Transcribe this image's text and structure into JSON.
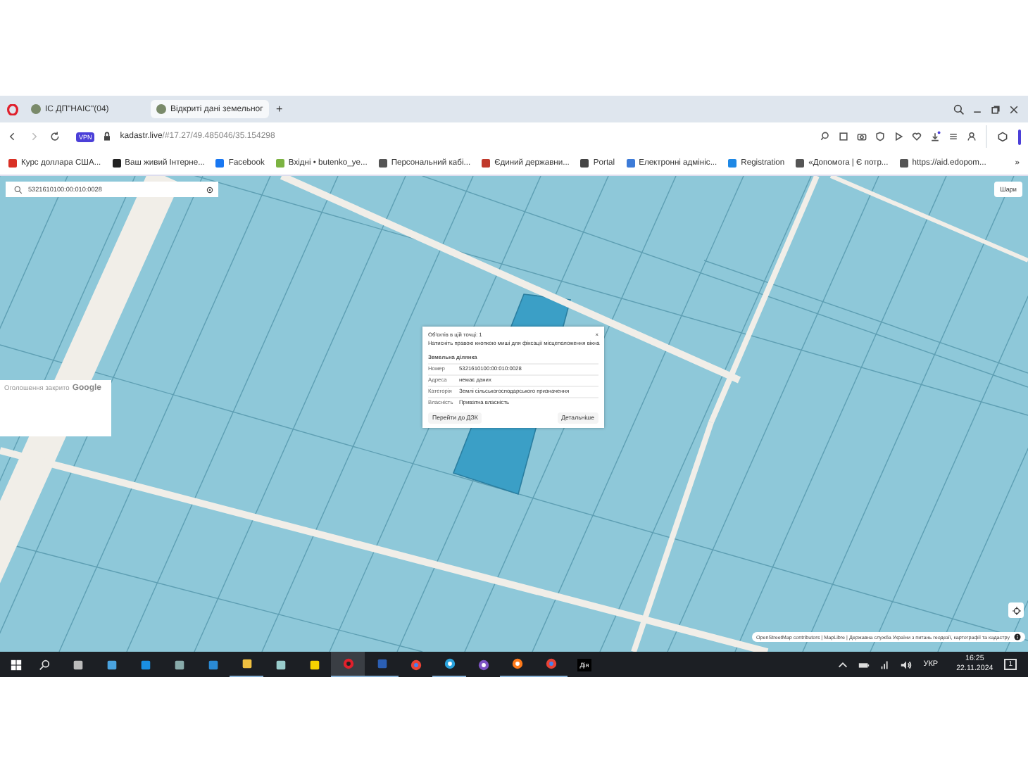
{
  "browser": {
    "tabs": [
      {
        "title": "ІС ДП\"НАІС\"(04)",
        "selected": false
      },
      {
        "title": "Відкриті дані земельног",
        "selected": true
      }
    ],
    "new_tab": "+",
    "address": {
      "host": "kadastr.live",
      "path": "/#17.27/49.485046/35.154298",
      "vpn": "VPN"
    },
    "bookmarks": [
      {
        "kind": "letter-m",
        "title": "Курс доллара США..."
      },
      {
        "kind": "dark-circle",
        "title": "Ваш живий Інтерне..."
      },
      {
        "kind": "facebook",
        "title": "Facebook"
      },
      {
        "kind": "mailbox",
        "title": "Вхідні • butenko_ye..."
      },
      {
        "kind": "seal",
        "title": "Персональний кабі..."
      },
      {
        "kind": "person",
        "title": "Єдиний державни..."
      },
      {
        "kind": "document",
        "title": "Portal"
      },
      {
        "kind": "globe",
        "title": "Електронні адмініс..."
      },
      {
        "kind": "square",
        "title": "Registration"
      },
      {
        "kind": "shield",
        "title": "«Допомога | Є потр..."
      },
      {
        "kind": "shield",
        "title": "https://aid.edopom..."
      }
    ],
    "bookmarks_more": "»"
  },
  "map": {
    "search": {
      "value": "5321610100:00:010:0028"
    },
    "layers_button": "Шари",
    "ad_notice": {
      "text": "Оголошення закрито",
      "brand": "Google"
    },
    "attribution": "OpenStreetMap contributors | MapLibre | Державна служба України з питань геодезії, картографії та кадастру",
    "popup": {
      "objects_count": "Об'єктів в цій точці: 1",
      "close": "×",
      "hint": "Натисніть правою кнопкою миші для фіксації місцеположення вікна",
      "heading": "Земельна ділянка",
      "fields": [
        {
          "label": "Номер",
          "value": "5321610100:00:010:0028"
        },
        {
          "label": "Адреса",
          "value": "немає даних"
        },
        {
          "label": "Категорія",
          "value": "Землі сільськогосподарського призначення"
        },
        {
          "label": "Власність",
          "value": "Приватна власність"
        }
      ],
      "buttons": [
        "Перейти до ДЗК",
        "Детальніше"
      ]
    }
  },
  "taskbar": {
    "apps": [
      {
        "kind": "search",
        "running": false,
        "selected": false
      },
      {
        "kind": "printer",
        "running": false,
        "selected": false
      },
      {
        "kind": "monitor",
        "running": false,
        "selected": false
      },
      {
        "kind": "edge",
        "running": false,
        "selected": false
      },
      {
        "kind": "calculator",
        "running": false,
        "selected": false
      },
      {
        "kind": "mail",
        "running": false,
        "selected": false
      },
      {
        "kind": "folder",
        "running": true,
        "selected": false
      },
      {
        "kind": "notepad",
        "running": false,
        "selected": false
      },
      {
        "kind": "ie",
        "running": false,
        "selected": false
      },
      {
        "kind": "opera",
        "running": true,
        "selected": true
      },
      {
        "kind": "word",
        "running": true,
        "selected": false
      },
      {
        "kind": "chrome",
        "running": false,
        "selected": false
      },
      {
        "kind": "telegram",
        "running": true,
        "selected": false
      },
      {
        "kind": "viber",
        "running": false,
        "selected": false
      },
      {
        "kind": "firefox",
        "running": true,
        "selected": false
      },
      {
        "kind": "chrome",
        "running": true,
        "selected": false
      },
      {
        "kind": "label",
        "label": "Дія",
        "running": false,
        "selected": false
      }
    ],
    "language": "УКР",
    "time": "16:25",
    "date": "22.11.2024",
    "notifications": "1"
  }
}
